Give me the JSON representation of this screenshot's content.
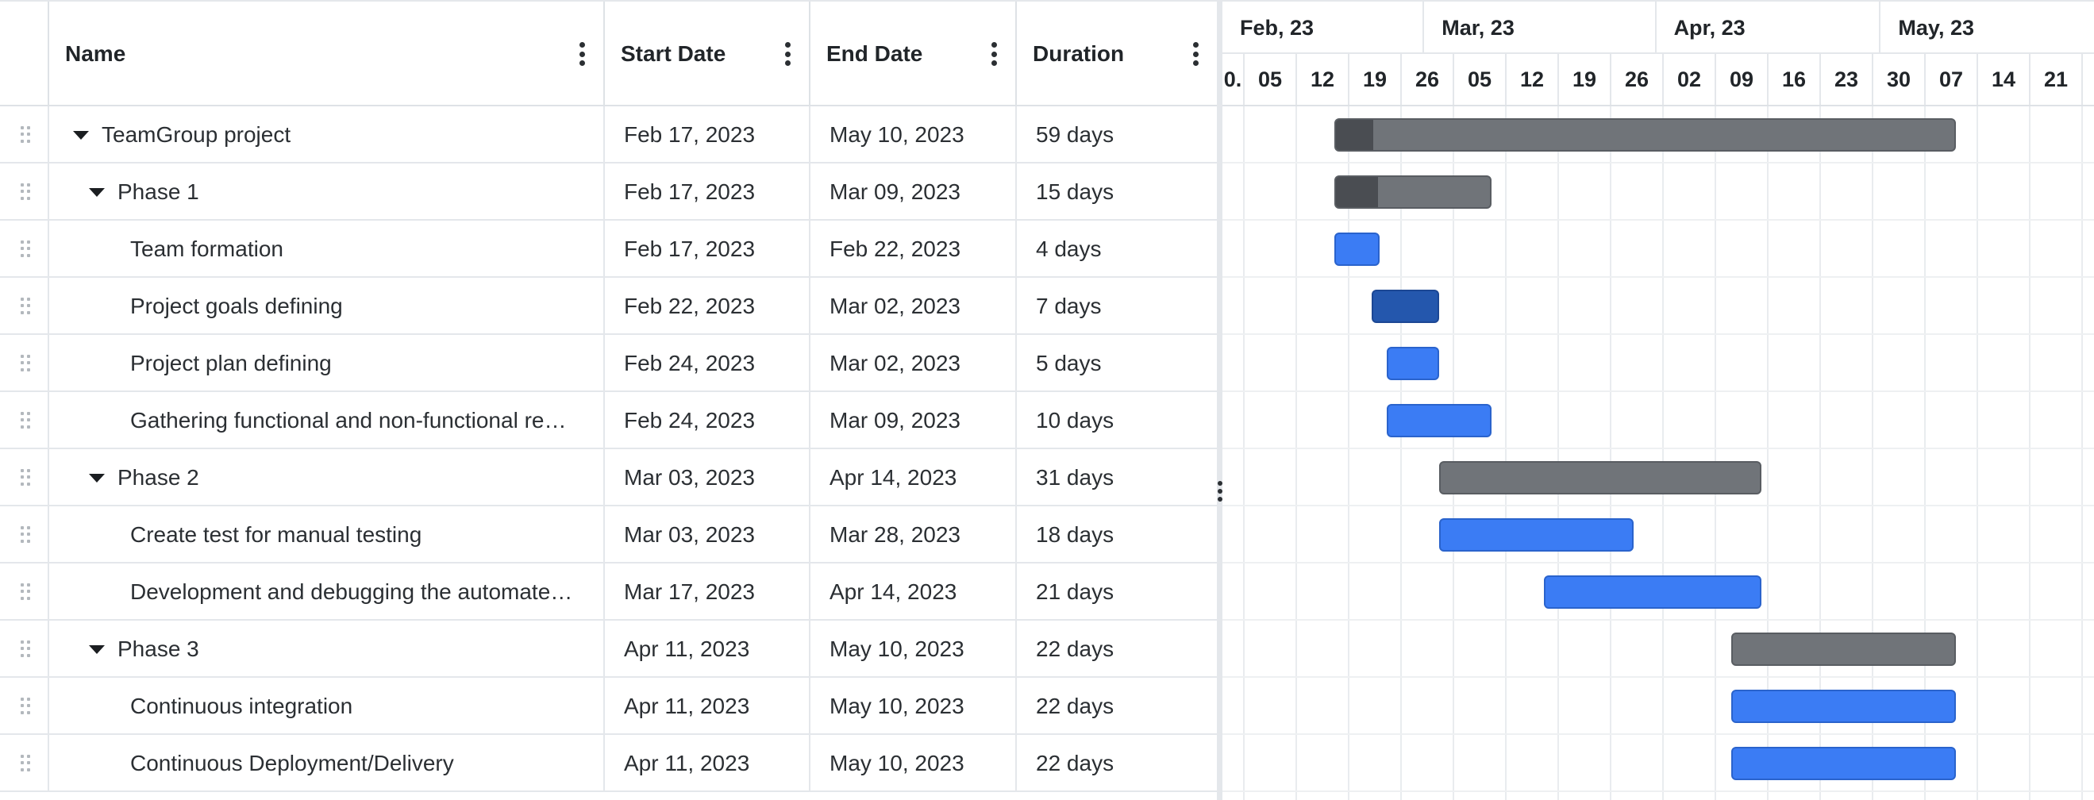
{
  "grid": {
    "columns": [
      {
        "key": "name",
        "label": "Name"
      },
      {
        "key": "start",
        "label": "Start Date"
      },
      {
        "key": "end",
        "label": "End Date"
      },
      {
        "key": "duration",
        "label": "Duration"
      }
    ],
    "rows": [
      {
        "name": "TeamGroup project",
        "start": "Feb 17, 2023",
        "end": "May 10, 2023",
        "duration": "59 days",
        "level": 0,
        "parent": true,
        "expanded": true
      },
      {
        "name": "Phase 1",
        "start": "Feb 17, 2023",
        "end": "Mar 09, 2023",
        "duration": "15 days",
        "level": 1,
        "parent": true,
        "expanded": true
      },
      {
        "name": "Team formation",
        "start": "Feb 17, 2023",
        "end": "Feb 22, 2023",
        "duration": "4 days",
        "level": 2,
        "parent": false
      },
      {
        "name": "Project goals defining",
        "start": "Feb 22, 2023",
        "end": "Mar 02, 2023",
        "duration": "7 days",
        "level": 2,
        "parent": false
      },
      {
        "name": "Project plan defining",
        "start": "Feb 24, 2023",
        "end": "Mar 02, 2023",
        "duration": "5 days",
        "level": 2,
        "parent": false
      },
      {
        "name": "Gathering functional and non-functional re…",
        "start": "Feb 24, 2023",
        "end": "Mar 09, 2023",
        "duration": "10 days",
        "level": 2,
        "parent": false
      },
      {
        "name": "Phase 2",
        "start": "Mar 03, 2023",
        "end": "Apr 14, 2023",
        "duration": "31 days",
        "level": 1,
        "parent": true,
        "expanded": true
      },
      {
        "name": "Create test for manual testing",
        "start": "Mar 03, 2023",
        "end": "Mar 28, 2023",
        "duration": "18 days",
        "level": 2,
        "parent": false
      },
      {
        "name": "Development and debugging the automate…",
        "start": "Mar 17, 2023",
        "end": "Apr 14, 2023",
        "duration": "21 days",
        "level": 2,
        "parent": false
      },
      {
        "name": "Phase 3",
        "start": "Apr 11, 2023",
        "end": "May 10, 2023",
        "duration": "22 days",
        "level": 1,
        "parent": true,
        "expanded": true
      },
      {
        "name": "Continuous integration",
        "start": "Apr 11, 2023",
        "end": "May 10, 2023",
        "duration": "22 days",
        "level": 2,
        "parent": false
      },
      {
        "name": "Continuous Deployment/Delivery",
        "start": "Apr 11, 2023",
        "end": "May 10, 2023",
        "duration": "22 days",
        "level": 2,
        "parent": false
      }
    ]
  },
  "timeline": {
    "months": [
      "Feb, 23",
      "Mar, 23",
      "Apr, 23",
      "May, 23"
    ],
    "weeks": [
      "0.",
      "05",
      "12",
      "19",
      "26",
      "05",
      "12",
      "19",
      "26",
      "02",
      "09",
      "16",
      "23",
      "30",
      "07",
      "14",
      "21"
    ]
  },
  "bars": [
    {
      "start": "2023-02-17",
      "end": "2023-05-10",
      "type": "parent",
      "progress": 0.06
    },
    {
      "start": "2023-02-17",
      "end": "2023-03-09",
      "type": "parent",
      "progress": 0.27
    },
    {
      "start": "2023-02-17",
      "end": "2023-02-22",
      "type": "task"
    },
    {
      "start": "2023-02-22",
      "end": "2023-03-02",
      "type": "task",
      "selected": true
    },
    {
      "start": "2023-02-24",
      "end": "2023-03-02",
      "type": "task"
    },
    {
      "start": "2023-02-24",
      "end": "2023-03-09",
      "type": "task"
    },
    {
      "start": "2023-03-03",
      "end": "2023-04-14",
      "type": "parent",
      "progress": 0
    },
    {
      "start": "2023-03-03",
      "end": "2023-03-28",
      "type": "task"
    },
    {
      "start": "2023-03-17",
      "end": "2023-04-14",
      "type": "task"
    },
    {
      "start": "2023-04-11",
      "end": "2023-05-10",
      "type": "parent",
      "progress": 0
    },
    {
      "start": "2023-04-11",
      "end": "2023-05-10",
      "type": "task"
    },
    {
      "start": "2023-04-11",
      "end": "2023-05-10",
      "type": "task"
    }
  ],
  "colors": {
    "task_bar": "#3b7cf4",
    "task_bar_selected": "#2457ad",
    "parent_bar": "#707479",
    "parent_progress": "#4a4d52",
    "grid_lines": "#e4e7eb"
  },
  "icons": {
    "column_menu": "kebab-vertical-icon",
    "row_drag": "drag-handle-icon",
    "expand": "caret-down-icon",
    "splitter": "splitter-dots-icon"
  }
}
